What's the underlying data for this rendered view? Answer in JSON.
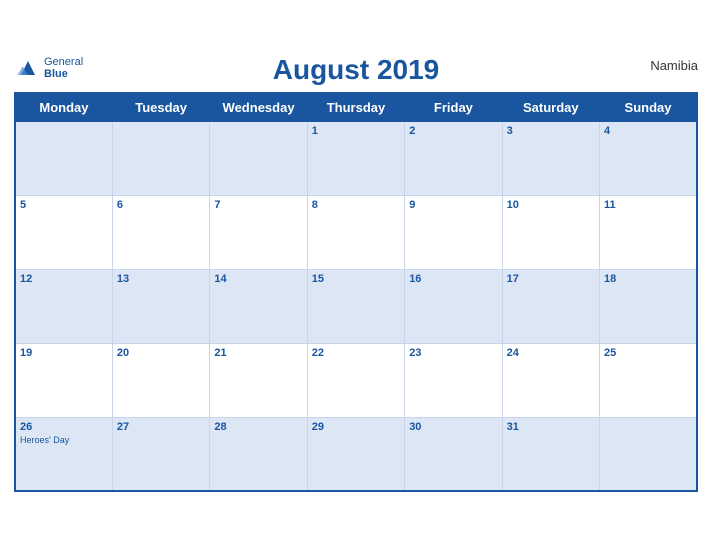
{
  "header": {
    "brand_general": "General",
    "brand_blue": "Blue",
    "title": "August 2019",
    "country": "Namibia"
  },
  "weekdays": [
    "Monday",
    "Tuesday",
    "Wednesday",
    "Thursday",
    "Friday",
    "Saturday",
    "Sunday"
  ],
  "rows": [
    [
      {
        "day": null
      },
      {
        "day": null
      },
      {
        "day": null
      },
      {
        "day": "1"
      },
      {
        "day": "2"
      },
      {
        "day": "3"
      },
      {
        "day": "4"
      }
    ],
    [
      {
        "day": "5"
      },
      {
        "day": "6"
      },
      {
        "day": "7"
      },
      {
        "day": "8"
      },
      {
        "day": "9"
      },
      {
        "day": "10"
      },
      {
        "day": "11"
      }
    ],
    [
      {
        "day": "12"
      },
      {
        "day": "13"
      },
      {
        "day": "14"
      },
      {
        "day": "15"
      },
      {
        "day": "16"
      },
      {
        "day": "17"
      },
      {
        "day": "18"
      }
    ],
    [
      {
        "day": "19"
      },
      {
        "day": "20"
      },
      {
        "day": "21"
      },
      {
        "day": "22"
      },
      {
        "day": "23"
      },
      {
        "day": "24"
      },
      {
        "day": "25"
      }
    ],
    [
      {
        "day": "26",
        "holiday": "Heroes' Day"
      },
      {
        "day": "27"
      },
      {
        "day": "28"
      },
      {
        "day": "29"
      },
      {
        "day": "30"
      },
      {
        "day": "31"
      },
      {
        "day": null
      }
    ]
  ]
}
